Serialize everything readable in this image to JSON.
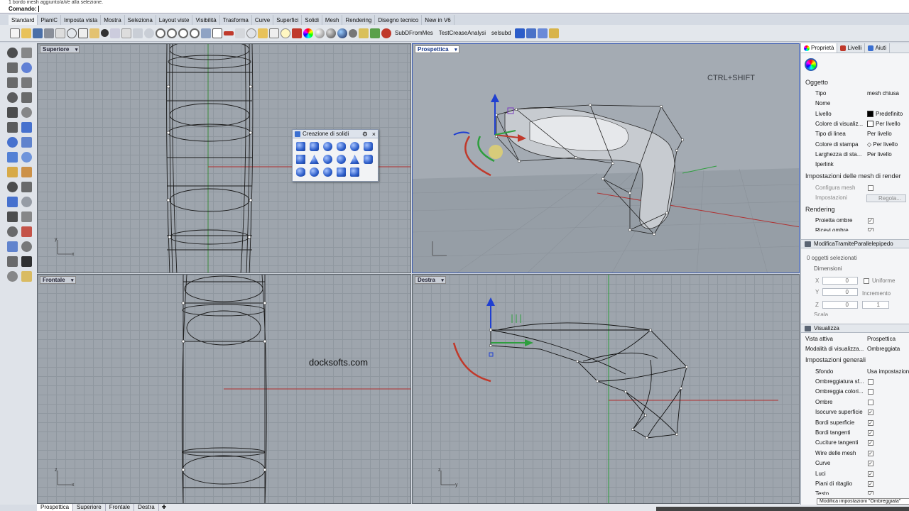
{
  "command": {
    "history": "1 bordo mesh aggiunto/a/i/e alla selezione.",
    "prompt_label": "Comando:"
  },
  "menu_tabs": [
    "Standard",
    "PianiC",
    "Imposta vista",
    "Mostra",
    "Seleziona",
    "Layout viste",
    "Visibilità",
    "Trasforma",
    "Curve",
    "Superfici",
    "Solidi",
    "Mesh",
    "Rendering",
    "Disegno tecnico",
    "New in V6"
  ],
  "toolbar": {
    "text_buttons": [
      "SubDFromMes",
      "TestCreaseAnalysi",
      "selsubd"
    ]
  },
  "viewports": {
    "top": "Superiore",
    "perspective": "Prospettica",
    "front": "Frontale",
    "right": "Destra"
  },
  "watermark": "docksofts.com",
  "overlay_hint": "CTRL+SHIFT",
  "solid_panel": {
    "title": "Creazione di solidi"
  },
  "bottom_tabs": [
    "Prospettica",
    "Superiore",
    "Frontale",
    "Destra"
  ],
  "right_panel": {
    "tabs": [
      "Proprietà",
      "Livelli",
      "Aiuti"
    ],
    "object_section": "Oggetto",
    "object_props": [
      {
        "key": "Tipo",
        "value": "mesh chiusa"
      },
      {
        "key": "Nome",
        "value": ""
      },
      {
        "key": "Livello",
        "value": "Predefinito"
      },
      {
        "key": "Colore di visualiz...",
        "value": "Per livello"
      },
      {
        "key": "Tipo di linea",
        "value": "Per livello"
      },
      {
        "key": "Colore di stampa",
        "value": "Per livello"
      },
      {
        "key": "Larghezza di sta...",
        "value": "Per livello"
      },
      {
        "key": "Iperlink",
        "value": ""
      }
    ],
    "mesh_settings_section": "Impostazioni delle mesh di render",
    "mesh_settings": {
      "custom_mesh": "Configura mesh",
      "settings": "Impostazioni",
      "adjust_button": "Regola..."
    },
    "rendering_section": "Rendering",
    "rendering_props": [
      "Proietta ombre",
      "Ricevi ombre"
    ],
    "modify_panel": {
      "title": "ModificaTramiteParallelepipedo",
      "selected": "0 oggetti selezionati",
      "dimensions": "Dimensioni",
      "x_label": "X",
      "y_label": "Y",
      "z_label": "Z",
      "x_value": "0",
      "y_value": "0",
      "z_value": "0",
      "uniform": "Uniforme",
      "increment": "Incremento",
      "increment_value": "1",
      "scale": "Scala"
    },
    "display_panel": {
      "title": "Visualizza",
      "active_view_label": "Vista attiva",
      "active_view_value": "Prospettica",
      "display_mode_label": "Modalità di visualizza...",
      "display_mode_value": "Ombreggiata",
      "general_settings": "Impostazioni generali",
      "background_label": "Sfondo",
      "background_value": "Usa impostazioni",
      "options": [
        {
          "label": "Ombreggiatura sf...",
          "checked": false
        },
        {
          "label": "Ombreggia colori...",
          "checked": false
        },
        {
          "label": "Ombre",
          "checked": false
        },
        {
          "label": "Isocurve superficie",
          "checked": true
        },
        {
          "label": "Bordi superficie",
          "checked": true
        },
        {
          "label": "Bordi tangenti",
          "checked": true
        },
        {
          "label": "Cuciture tangenti",
          "checked": true
        },
        {
          "label": "Wire delle mesh",
          "checked": true
        },
        {
          "label": "Curve",
          "checked": true
        },
        {
          "label": "Luci",
          "checked": true
        },
        {
          "label": "Piani di ritaglio",
          "checked": true
        },
        {
          "label": "Testo",
          "checked": true
        }
      ],
      "tooltip": "Modifica impostazioni \"Ombreggiata\""
    }
  },
  "colors": {
    "accent": "#2b5fb3",
    "viewport_bg": "#9ea5ad",
    "axis_red": "#c0392b",
    "axis_green": "#2e9e3e",
    "gumball_blue": "#1f3fd1"
  }
}
